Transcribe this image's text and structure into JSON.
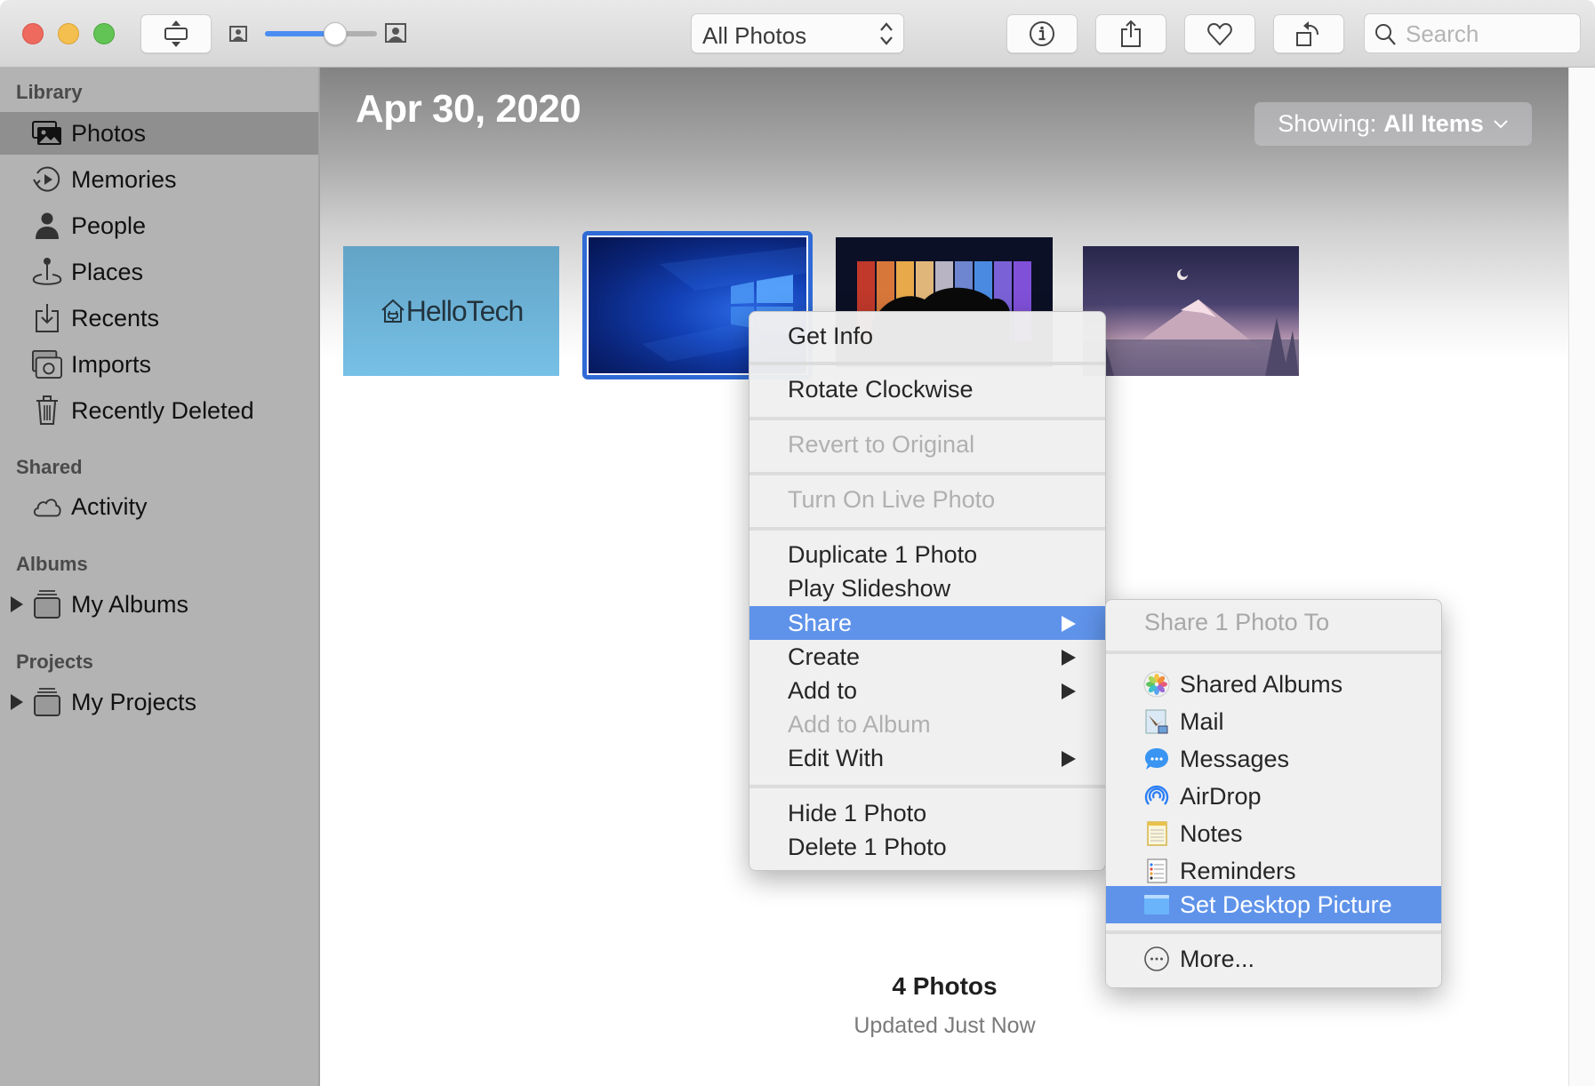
{
  "toolbar": {
    "view_mode_button": "fit-toggle",
    "zoom_slider": {
      "value_percent": 63
    },
    "view_popup": {
      "selected": "All Photos"
    },
    "buttons": [
      {
        "name": "info",
        "icon": "info-icon"
      },
      {
        "name": "share",
        "icon": "share-icon"
      },
      {
        "name": "favorite",
        "icon": "heart-icon"
      },
      {
        "name": "rotate",
        "icon": "rotate-icon"
      }
    ],
    "search": {
      "placeholder": "Search",
      "value": ""
    }
  },
  "sidebar": {
    "sections": [
      {
        "label": "Library"
      },
      {
        "label": "Shared"
      },
      {
        "label": "Albums"
      },
      {
        "label": "Projects"
      }
    ],
    "library_items": [
      {
        "label": "Photos",
        "icon": "photos-icon",
        "selected": true
      },
      {
        "label": "Memories",
        "icon": "memories-icon"
      },
      {
        "label": "People",
        "icon": "person-icon"
      },
      {
        "label": "Places",
        "icon": "pin-icon"
      },
      {
        "label": "Recents",
        "icon": "import-tray-icon"
      },
      {
        "label": "Imports",
        "icon": "camera-icon"
      },
      {
        "label": "Recently Deleted",
        "icon": "trash-icon"
      }
    ],
    "shared_items": [
      {
        "label": "Activity",
        "icon": "cloud-icon"
      }
    ],
    "albums_items": [
      {
        "label": "My Albums",
        "icon": "folder-stack-icon",
        "expandable": true
      }
    ],
    "projects_items": [
      {
        "label": "My Projects",
        "icon": "folder-stack-icon",
        "expandable": true
      }
    ]
  },
  "main": {
    "date_title": "Apr 30, 2020",
    "showing": {
      "label": "Showing:",
      "value": "All Items"
    },
    "thumbnails": [
      {
        "description": "HelloTech logo on light blue",
        "brand_text": "HelloTech",
        "selected": false
      },
      {
        "description": "Windows 10 blue wallpaper",
        "selected": true
      },
      {
        "description": "Tree silhouette color spectrum panels",
        "selected": false
      },
      {
        "description": "Purple mountain night landscape with crescent moon",
        "selected": false
      }
    ],
    "footer": {
      "count": "4 Photos",
      "status": "Updated Just Now"
    }
  },
  "context_menu": {
    "items": [
      {
        "label": "Get Info",
        "enabled": true
      },
      {
        "label": "Rotate Clockwise",
        "enabled": true
      },
      {
        "label": "Revert to Original",
        "enabled": false
      },
      {
        "label": "Turn On Live Photo",
        "enabled": false
      },
      {
        "label": "Duplicate 1 Photo",
        "enabled": true
      },
      {
        "label": "Play Slideshow",
        "enabled": true
      },
      {
        "label": "Share",
        "enabled": true,
        "submenu": true,
        "highlighted": true
      },
      {
        "label": "Create",
        "enabled": true,
        "submenu": true
      },
      {
        "label": "Add to",
        "enabled": true,
        "submenu": true
      },
      {
        "label": "Add to Album",
        "enabled": false
      },
      {
        "label": "Edit With",
        "enabled": true,
        "submenu": true
      },
      {
        "label": "Hide 1 Photo",
        "enabled": true
      },
      {
        "label": "Delete 1 Photo",
        "enabled": true
      }
    ]
  },
  "share_submenu": {
    "header": "Share 1 Photo To",
    "items": [
      {
        "label": "Shared Albums",
        "icon": "photos-app-icon"
      },
      {
        "label": "Mail",
        "icon": "mail-app-icon"
      },
      {
        "label": "Messages",
        "icon": "messages-app-icon"
      },
      {
        "label": "AirDrop",
        "icon": "airdrop-icon"
      },
      {
        "label": "Notes",
        "icon": "notes-app-icon"
      },
      {
        "label": "Reminders",
        "icon": "reminders-app-icon"
      },
      {
        "label": "Set Desktop Picture",
        "icon": "desktop-picture-icon",
        "highlighted": true
      },
      {
        "label": "More...",
        "icon": "more-icon"
      }
    ]
  },
  "colors": {
    "highlight": "#5f93ea",
    "selection_border": "#2f6ad6",
    "sidebar_bg": "#b3b3b3",
    "sidebar_selected": "#8f8f8f"
  }
}
